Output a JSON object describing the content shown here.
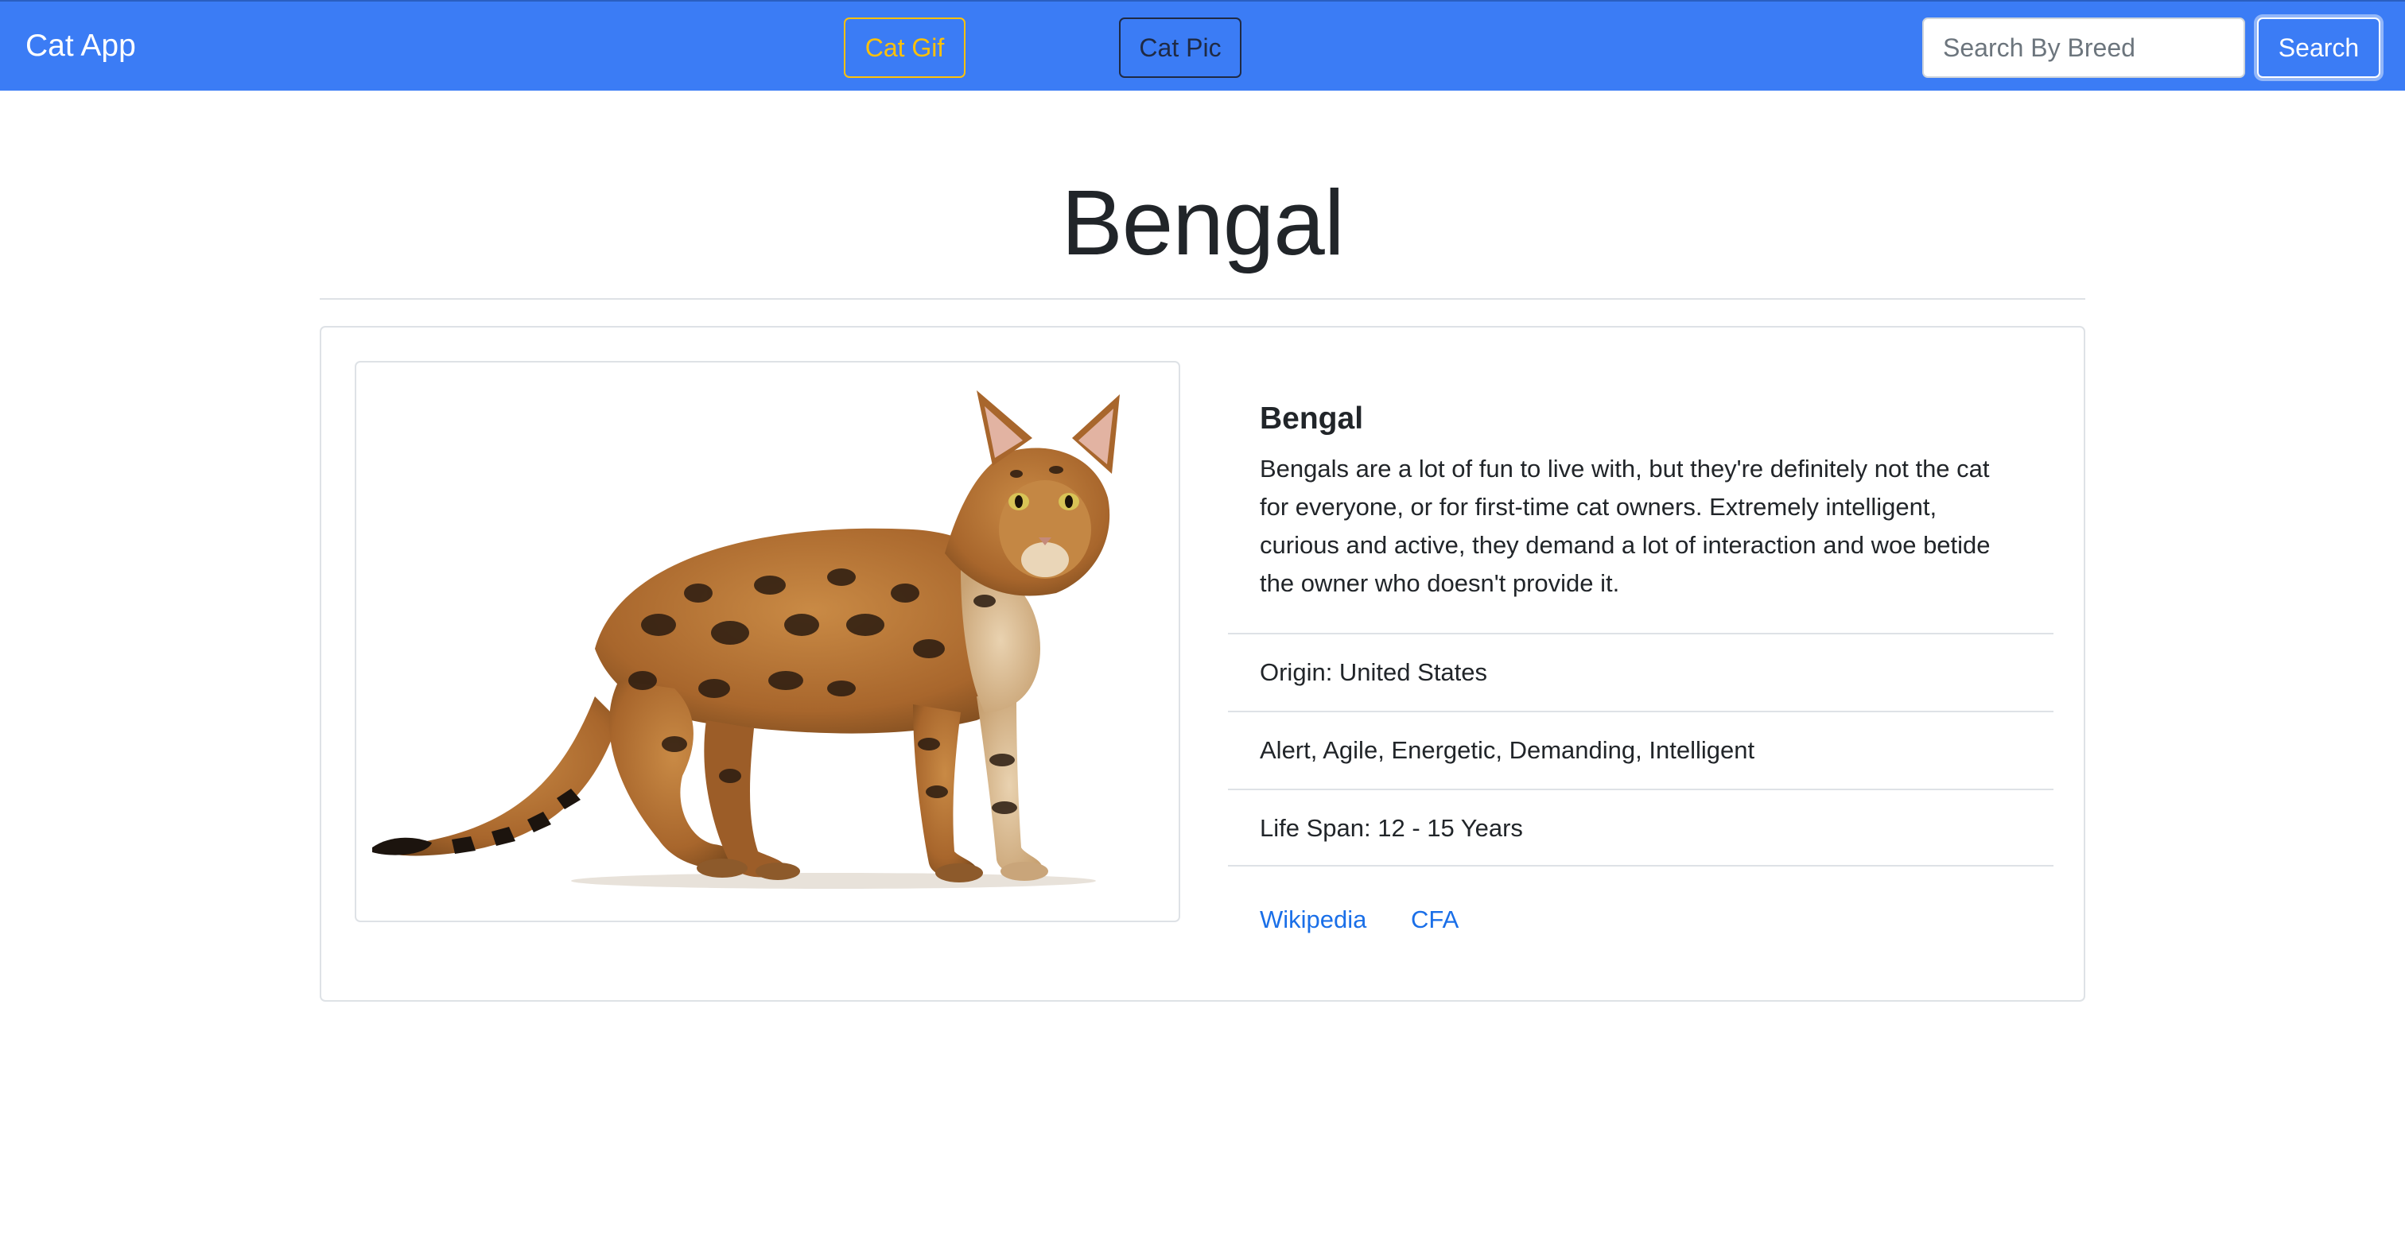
{
  "navbar": {
    "brand": "Cat App",
    "cat_gif_label": "Cat Gif",
    "cat_pic_label": "Cat Pic",
    "search_placeholder": "Search By Breed",
    "search_label": "Search",
    "bg_color": "#3b7cf5"
  },
  "page": {
    "title": "Bengal"
  },
  "breed": {
    "name": "Bengal",
    "description": "Bengals are a lot of fun to live with, but they're definitely not the cat for everyone, or for first-time cat owners. Extremely intelligent, curious and active, they demand a lot of interaction and woe betide the owner who doesn't provide it.",
    "origin": "Origin: United States",
    "temperament": "Alert, Agile, Energetic, Demanding, Intelligent",
    "life_span": "Life Span: 12 - 15 Years",
    "links": {
      "wikipedia": "Wikipedia",
      "cfa": "CFA"
    }
  }
}
